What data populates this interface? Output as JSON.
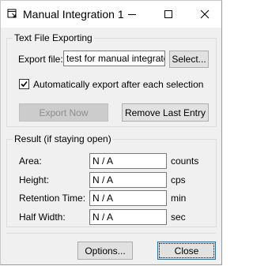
{
  "window": {
    "title": "Manual Integration 1",
    "controls": {
      "minimize": "minimize",
      "maximize": "maximize",
      "close": "close"
    }
  },
  "export_group": {
    "legend": "Text File Exporting",
    "export_file_label": "Export file:",
    "export_file_value": "test for manual integrate se",
    "select_button": "Select...",
    "auto_export_checked": true,
    "auto_export_label": "Automatically export after each selection",
    "export_now_button": "Export Now",
    "export_now_enabled": false,
    "remove_last_button": "Remove Last Entry"
  },
  "result_group": {
    "legend": "Result (if staying open)",
    "rows": [
      {
        "label": "Area:",
        "value": "N / A",
        "unit": "counts"
      },
      {
        "label": "Height:",
        "value": "N / A",
        "unit": "cps"
      },
      {
        "label": "Retention Time:",
        "value": "N / A",
        "unit": "min"
      },
      {
        "label": "Half Width:",
        "value": "N / A",
        "unit": "sec"
      }
    ]
  },
  "footer": {
    "options_button": "Options...",
    "close_button": "Close"
  },
  "colors": {
    "window_bg": "#f0f0f0",
    "titlebar_bg": "#ffffff",
    "button_bg": "#e1e1e1",
    "default_button_border": "#0078d7",
    "disabled_text": "#8d8d8d"
  },
  "icons": {
    "app": "app-window-icon",
    "checkmark": "checkmark-icon"
  }
}
